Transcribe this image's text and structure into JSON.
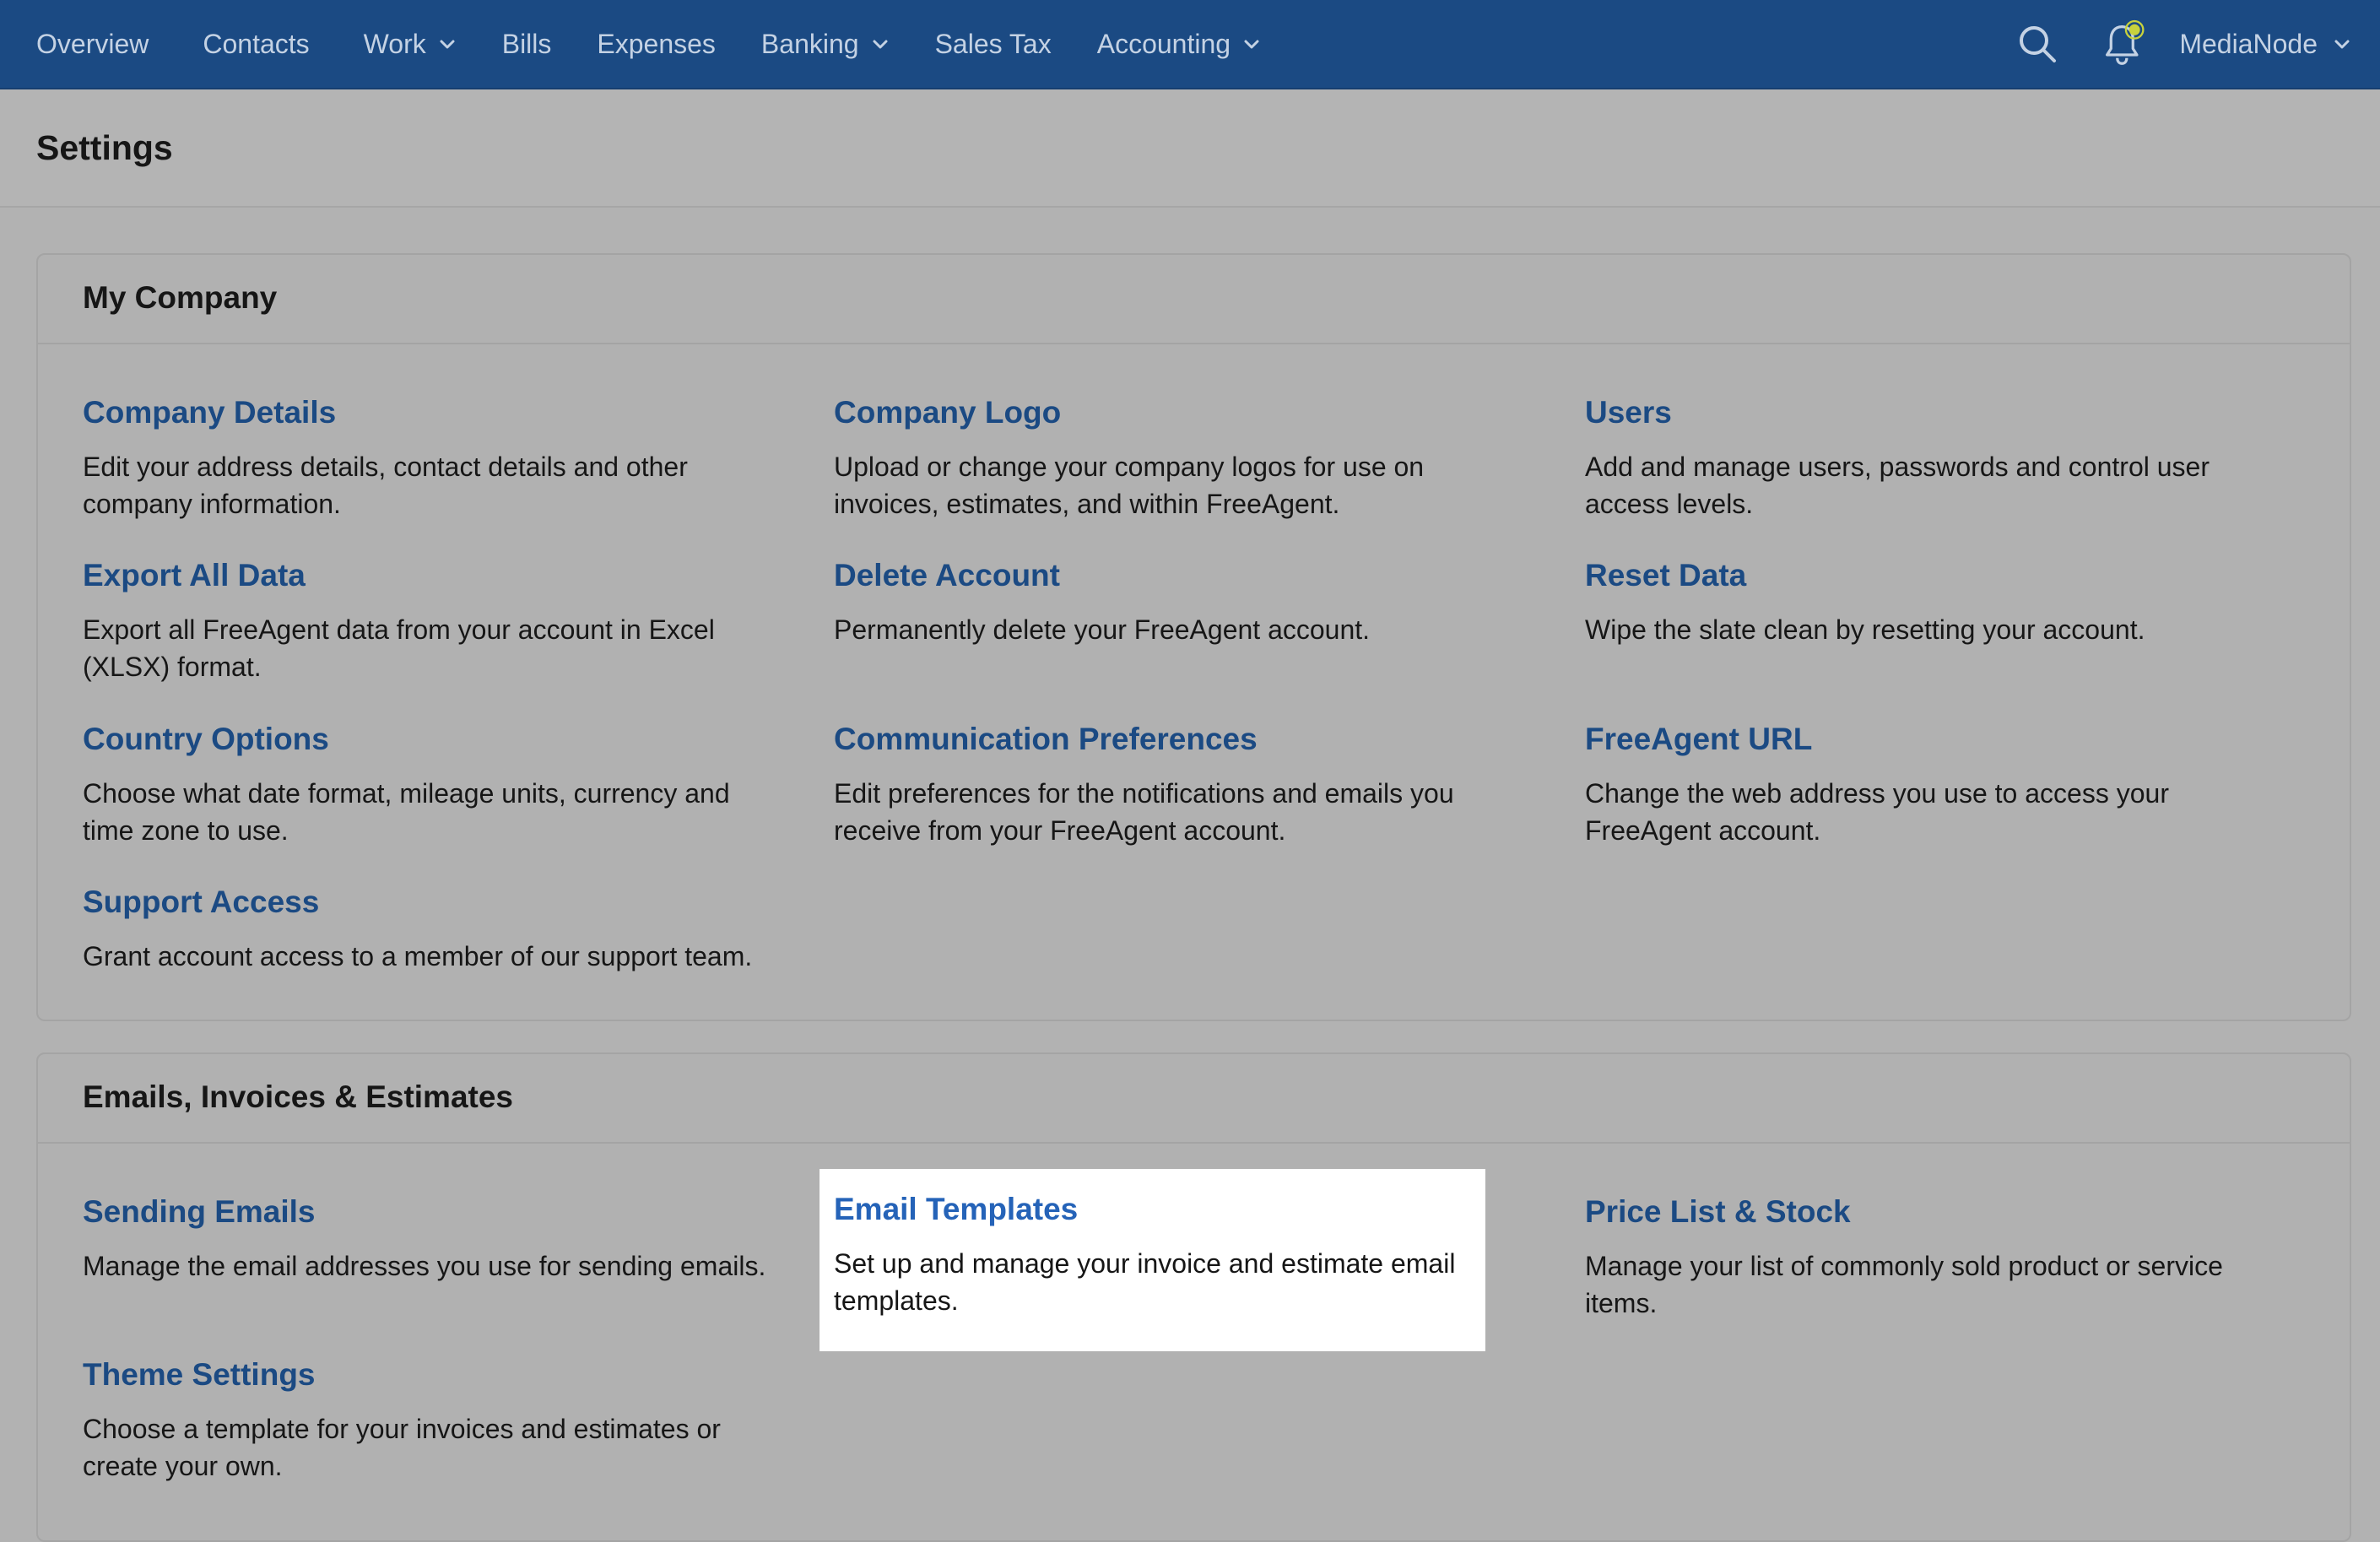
{
  "nav": {
    "items": [
      {
        "label": "Overview",
        "dropdown": false
      },
      {
        "label": "Contacts",
        "dropdown": false
      },
      {
        "label": "Work",
        "dropdown": true
      },
      {
        "label": "Bills",
        "dropdown": false
      },
      {
        "label": "Expenses",
        "dropdown": false
      },
      {
        "label": "Banking",
        "dropdown": true
      },
      {
        "label": "Sales Tax",
        "dropdown": false
      },
      {
        "label": "Accounting",
        "dropdown": true
      }
    ],
    "search_icon": "search-icon",
    "notification_icon": "bell-icon",
    "account_name": "MediaNode"
  },
  "page": {
    "title": "Settings"
  },
  "sections": [
    {
      "title": "My Company",
      "items": [
        {
          "title": "Company Details",
          "description": "Edit your address details, contact details and other company information."
        },
        {
          "title": "Company Logo",
          "description": "Upload or change your company logos for use on invoices, estimates, and within FreeAgent."
        },
        {
          "title": "Users",
          "description": "Add and manage users, passwords and control user access levels."
        },
        {
          "title": "Export All Data",
          "description": "Export all FreeAgent data from your account in Excel (XLSX) format."
        },
        {
          "title": "Delete Account",
          "description": "Permanently delete your FreeAgent account."
        },
        {
          "title": "Reset Data",
          "description": "Wipe the slate clean by resetting your account."
        },
        {
          "title": "Country Options",
          "description": "Choose what date format, mileage units, currency and time zone to use."
        },
        {
          "title": "Communication Preferences",
          "description": "Edit preferences for the notifications and emails you receive from your FreeAgent account."
        },
        {
          "title": "FreeAgent URL",
          "description": "Change the web address you use to access your FreeAgent account."
        },
        {
          "title": "Support Access",
          "description": "Grant account access to a member of our support team."
        }
      ]
    },
    {
      "title": "Emails, Invoices & Estimates",
      "items": [
        {
          "title": "Sending Emails",
          "description": "Manage the email addresses you use for sending emails."
        },
        {
          "title": "Email Templates",
          "description": "Set up and manage your invoice and estimate email templates.",
          "highlighted": true
        },
        {
          "title": "Price List & Stock",
          "description": "Manage your list of commonly sold product or service items."
        },
        {
          "title": "Theme Settings",
          "description": "Choose a template for your invoices and estimates or create your own."
        }
      ]
    }
  ],
  "colors": {
    "nav_bg": "#1b4a83",
    "link": "#1b4a83",
    "highlight_link": "#2563b8",
    "notification_dot": "#c8d23c"
  }
}
